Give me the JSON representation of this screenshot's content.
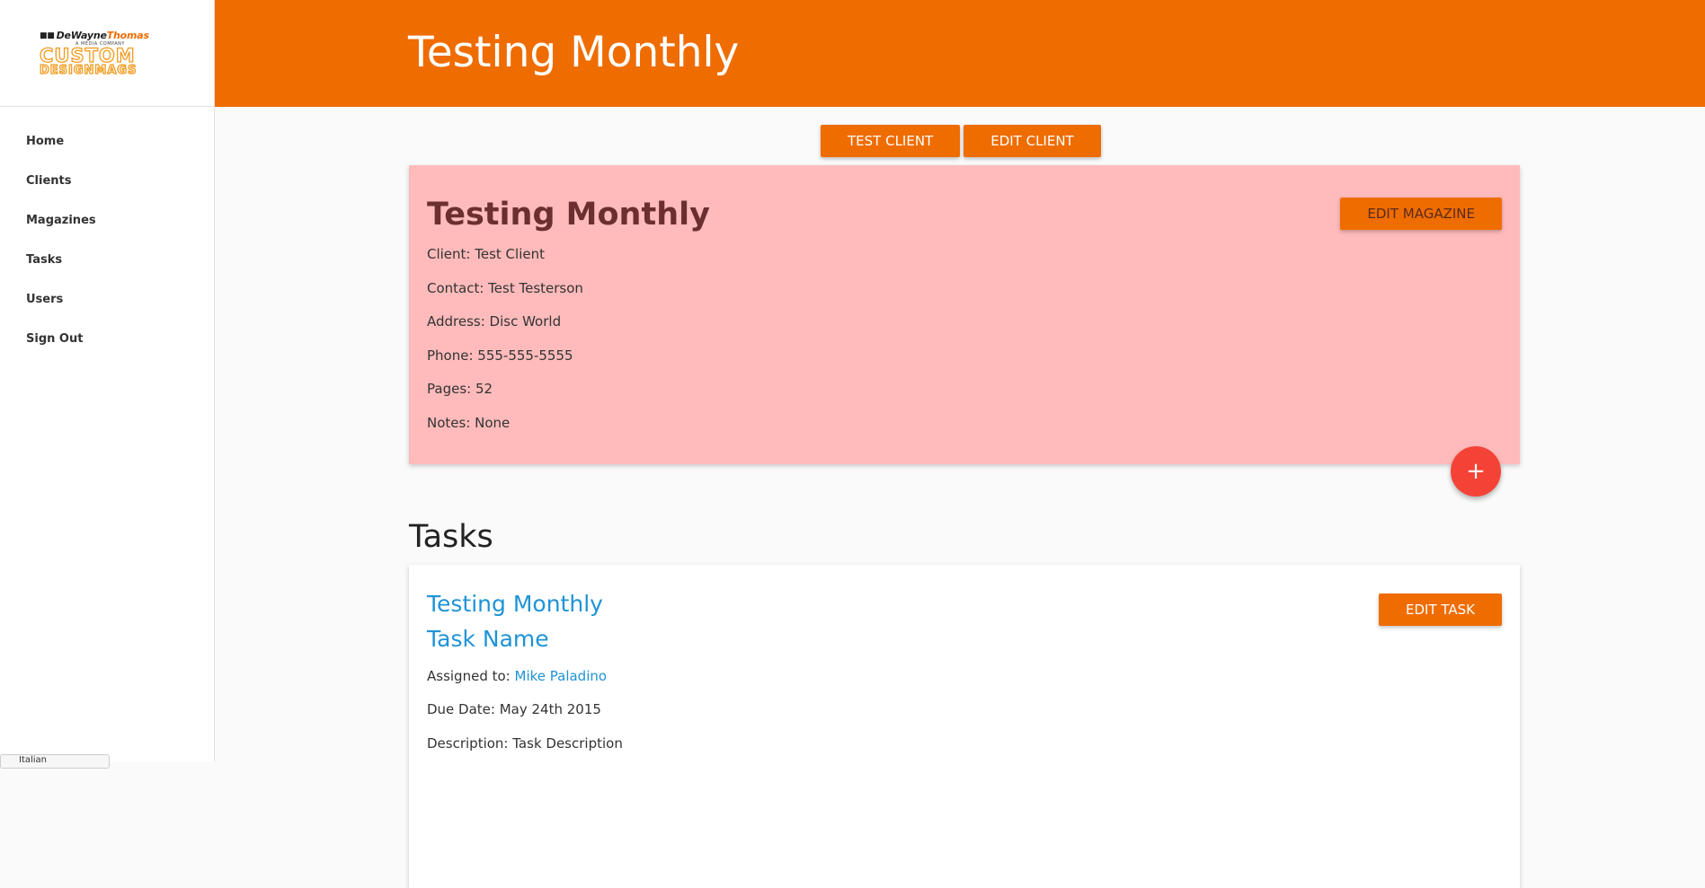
{
  "sidebar": {
    "logo": {
      "line1_dw": "DeWayne",
      "line1_th": "Thomas",
      "sub": "A MEDIA COMPANY",
      "custom": "CUSTOM",
      "mags": "DESIGNMAGS"
    },
    "nav": [
      "Home",
      "Clients",
      "Magazines",
      "Tasks",
      "Users",
      "Sign Out"
    ],
    "language_tab": "Italian"
  },
  "header": {
    "title": "Testing Monthly"
  },
  "client_buttons": {
    "test_client": "TEST CLIENT",
    "edit_client": "EDIT CLIENT"
  },
  "magazine": {
    "title": "Testing Monthly",
    "edit_label": "EDIT MAGAZINE",
    "client": "Client: Test Client",
    "contact": "Contact: Test Testerson",
    "address": "Address: Disc World",
    "phone": "Phone: 555-555-5555",
    "pages": "Pages: 52",
    "notes": "Notes: None"
  },
  "fab_label": "+",
  "tasks": {
    "heading": "Tasks",
    "items": [
      {
        "magazine": "Testing Monthly",
        "name": "Task Name",
        "edit_label": "EDIT TASK",
        "assigned_prefix": "Assigned to: ",
        "assigned_to": "Mike Paladino",
        "due_date": "Due Date: May 24th 2015",
        "description": "Description: Task Description"
      }
    ]
  },
  "colors": {
    "accent": "#ef6c00",
    "magazine_card": "#ffbbbb",
    "fab": "#f44336",
    "link": "#1e93d6"
  }
}
